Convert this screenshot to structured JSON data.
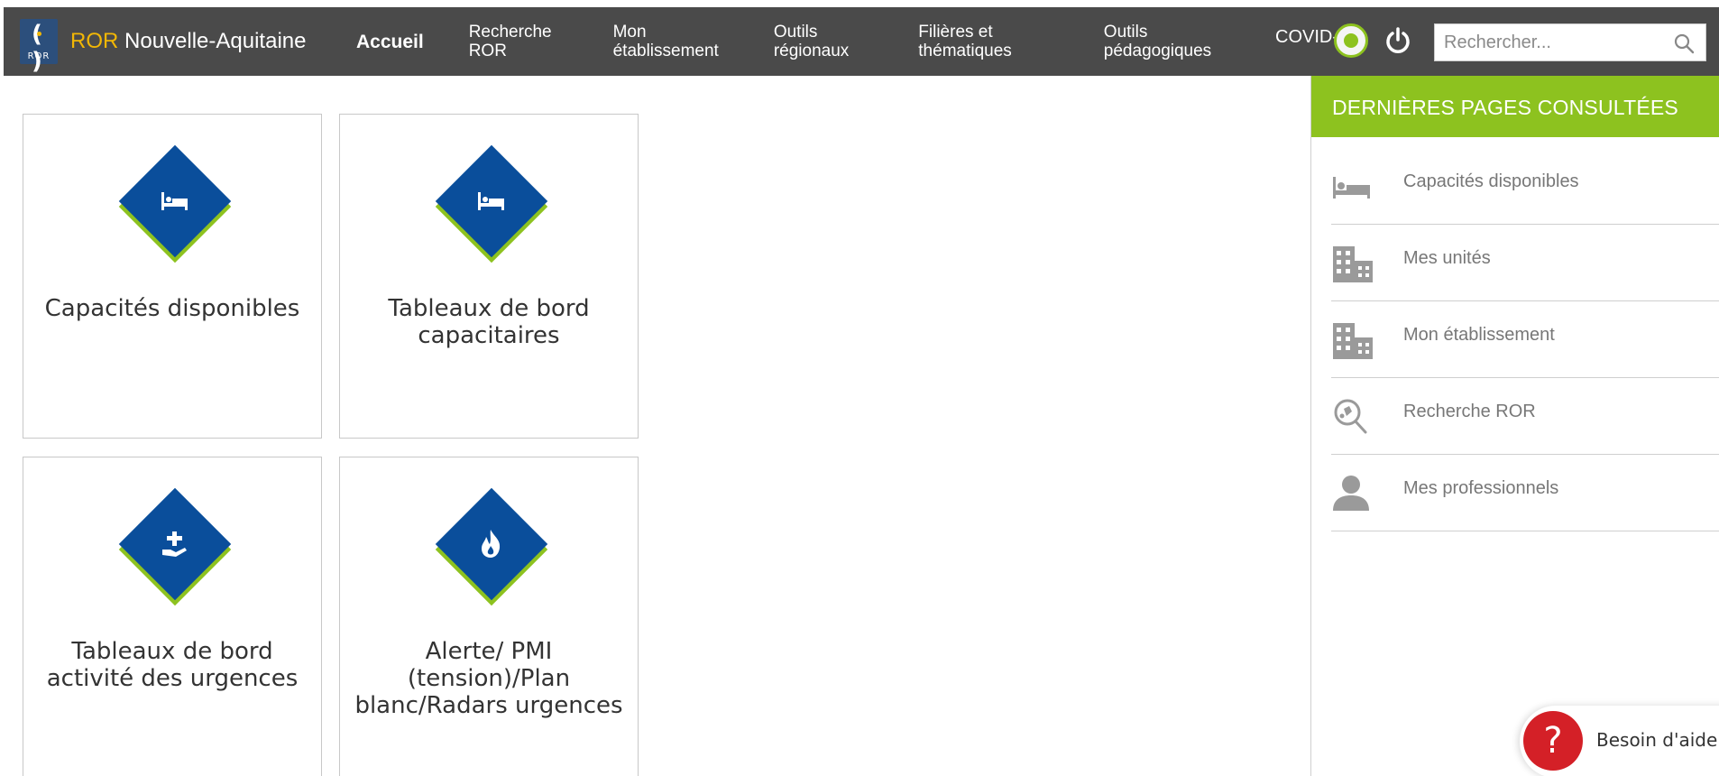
{
  "brand": {
    "logo_text": "ROR",
    "name_accent": "ROR",
    "name_rest": " Nouvelle-Aquitaine"
  },
  "nav": {
    "items": [
      {
        "label": "Accueil",
        "active": true
      },
      {
        "label": "Recherche\nROR"
      },
      {
        "label": "Mon\nétablissement"
      },
      {
        "label": "Outils\nrégionaux"
      },
      {
        "label": "Filières et\nthématiques"
      },
      {
        "label": "Outils\npédagogiques"
      }
    ],
    "covid_label": "COVID-",
    "covid_icon": "virus-icon",
    "power_icon": "power-icon"
  },
  "search": {
    "placeholder": "Rechercher...",
    "value": "",
    "icon": "search-icon"
  },
  "tiles": [
    {
      "label": "Capacités disponibles",
      "icon": "bed-icon"
    },
    {
      "label": "Tableaux de bord capacitaires",
      "icon": "bed-icon"
    },
    {
      "label": "Tableaux de bord activité des urgences",
      "icon": "medical-hand-icon"
    },
    {
      "label": "Alerte/ PMI (tension)/Plan blanc/Radars urgences",
      "icon": "fire-icon"
    }
  ],
  "sidebar": {
    "title": "DERNIÈRES PAGES CONSULTÉES",
    "items": [
      {
        "label": "Capacités disponibles",
        "icon": "bed-icon"
      },
      {
        "label": "Mes unités",
        "icon": "building-icon"
      },
      {
        "label": "Mon établissement",
        "icon": "building-icon"
      },
      {
        "label": "Recherche ROR",
        "icon": "search-map-icon"
      },
      {
        "label": "Mes professionnels",
        "icon": "user-icon"
      }
    ]
  },
  "help": {
    "label": "Besoin d'aide ?",
    "icon_text": "?"
  },
  "colors": {
    "nav_bg": "#4a4a4a",
    "accent_green": "#8dc21f",
    "tile_blue": "#0a4e9b",
    "brand_yellow": "#f2b705",
    "help_red": "#d42027"
  }
}
